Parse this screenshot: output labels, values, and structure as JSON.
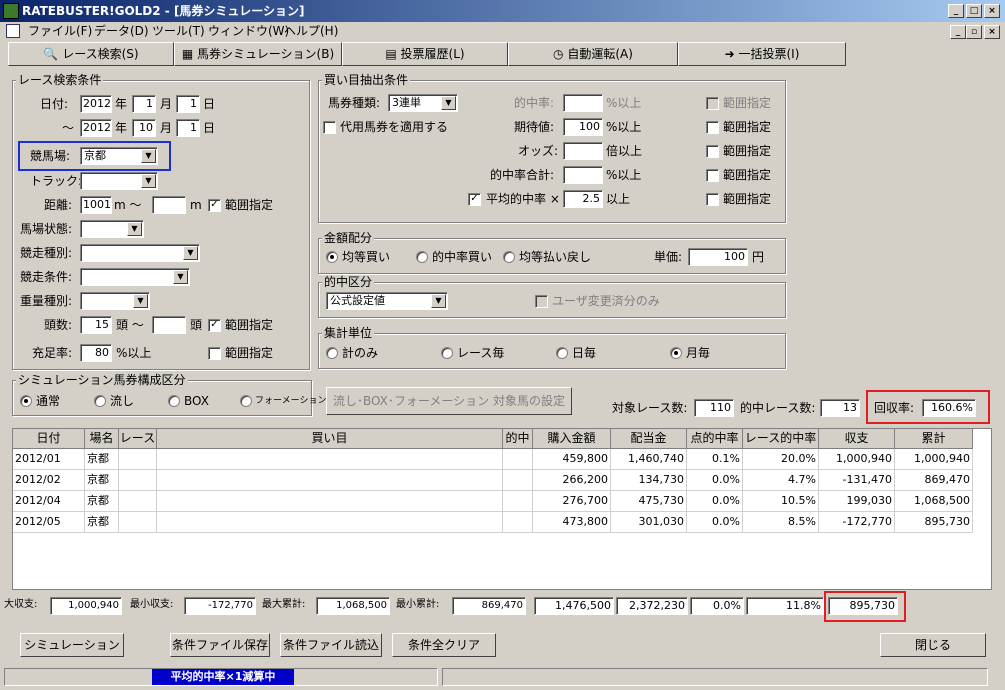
{
  "window": {
    "title": "RATEBUSTER!GOLD2 - [馬券シミュレーション]"
  },
  "menu": [
    "ファイル(F)",
    "データ(D)",
    "ツール(T)",
    "ウィンドウ(W)",
    "ヘルプ(H)"
  ],
  "tabs": [
    "レース検索(S)",
    "馬券シミュレーション(B)",
    "投票履歴(L)",
    "自動運転(A)",
    "一括投票(I)"
  ],
  "race": {
    "title": "レース検索条件",
    "date_label": "日付:",
    "from_year": "2012",
    "from_month": "1",
    "from_day": "1",
    "to_sep": "～",
    "to_year": "2012",
    "to_month": "10",
    "to_day": "1",
    "year_u": "年",
    "month_u": "月",
    "day_u": "日",
    "venue_label": "競馬場:",
    "venue": "京都",
    "track_label": "トラック:",
    "dist_label": "距離:",
    "dist_from": "1001",
    "dist_unit1": "m ～",
    "dist_unit2": "m",
    "range": "範囲指定",
    "cond_label": "馬場状態:",
    "type_label": "競走種別:",
    "rule_label": "競走条件:",
    "weight_label": "重量種別:",
    "heads_label": "頭数:",
    "heads_from": "15",
    "heads_unit1": "頭 ～",
    "heads_unit2": "頭",
    "fill_label": "充足率:",
    "fill": "80",
    "fill_unit": "%以上"
  },
  "buy": {
    "title": "買い目抽出条件",
    "type_label": "馬券種類:",
    "type": "3連単",
    "sub_label": "代用馬券を適用する",
    "hit_label": "的中率:",
    "hit_unit": "%以上",
    "exp_label": "期待値:",
    "exp": "100",
    "exp_unit": "%以上",
    "odds_label": "オッズ:",
    "odds_unit": "倍以上",
    "hitsum_label": "的中率合計:",
    "hitsum_unit": "%以上",
    "avg_label": "平均的中率 ×",
    "avg": "2.5",
    "avg_unit": "以上",
    "range": "範囲指定"
  },
  "alloc": {
    "title": "金額配分",
    "opt1": "均等買い",
    "opt2": "的中率買い",
    "opt3": "均等払い戻し",
    "unit_label": "単価:",
    "unit": "100",
    "yen": "円"
  },
  "hitcls": {
    "title": "的中区分",
    "value": "公式設定値",
    "user_label": "ユーザ変更済分のみ"
  },
  "agg": {
    "title": "集計単位",
    "opt1": "計のみ",
    "opt2": "レース毎",
    "opt3": "日毎",
    "opt4": "月毎"
  },
  "sim": {
    "title": "シミュレーション馬券構成区分",
    "opt1": "通常",
    "opt2": "流し",
    "opt3": "BOX",
    "opt4": "フォーメーション",
    "setup_btn": "流し･BOX･フォーメーション 対象馬の設定"
  },
  "stats": {
    "races_label": "対象レース数:",
    "races": "110",
    "hits_label": "的中レース数:",
    "hits": "13",
    "rr_label": "回収率:",
    "rr": "160.6%"
  },
  "table": {
    "headers": [
      "日付",
      "場名",
      "レース",
      "買い目",
      "的中",
      "購入金額",
      "配当金",
      "点的中率",
      "レース的中率",
      "収支",
      "累計"
    ],
    "rows": [
      [
        "2012/01",
        "京都",
        "",
        "",
        "",
        "459,800",
        "1,460,740",
        "0.1%",
        "20.0%",
        "1,000,940",
        "1,000,940"
      ],
      [
        "2012/02",
        "京都",
        "",
        "",
        "",
        "266,200",
        "134,730",
        "0.0%",
        "4.7%",
        "-131,470",
        "869,470"
      ],
      [
        "2012/04",
        "京都",
        "",
        "",
        "",
        "276,700",
        "475,730",
        "0.0%",
        "10.5%",
        "199,030",
        "1,068,500"
      ],
      [
        "2012/05",
        "京都",
        "",
        "",
        "",
        "473,800",
        "301,030",
        "0.0%",
        "8.5%",
        "-172,770",
        "895,730"
      ]
    ]
  },
  "summary": {
    "max_label": "大収支:",
    "max": "1,000,940",
    "min_label": "最小収支:",
    "min": "-172,770",
    "maxc_label": "最大累計:",
    "maxc": "1,068,500",
    "minc_label": "最小累計:",
    "minc": "869,470",
    "buy": "1,476,500",
    "pay": "2,372,230",
    "pt": "0.0%",
    "race": "11.8%",
    "total": "895,730"
  },
  "buttons": {
    "sim": "シミュレーション",
    "save": "条件ファイル保存",
    "load": "条件ファイル読込",
    "clear": "条件全クリア",
    "close": "閉じる"
  },
  "status": "平均的中率×1減算中"
}
